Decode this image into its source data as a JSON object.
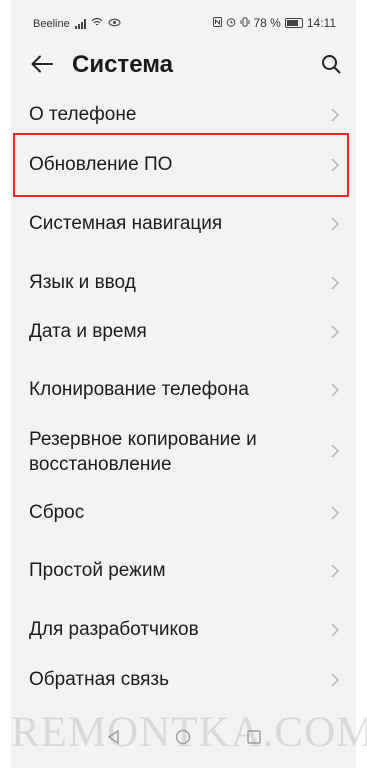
{
  "status_bar": {
    "carrier": "Beeline",
    "battery_percent": "78 %",
    "time": "14:11"
  },
  "header": {
    "title": "Система",
    "back_icon": "arrow-left-icon",
    "search_icon": "search-icon"
  },
  "menu": {
    "items": [
      {
        "label": "О телефоне"
      },
      {
        "label": "Обновление ПО",
        "highlighted": true
      },
      {
        "label": "Системная навигация"
      },
      {
        "label": "Язык и ввод"
      },
      {
        "label": "Дата и время"
      },
      {
        "label": "Клонирование телефона"
      },
      {
        "label": "Резервное копирование и",
        "label_line2": "восстановление"
      },
      {
        "label": "Сброс"
      },
      {
        "label": "Простой режим"
      },
      {
        "label": "Для разработчиков"
      },
      {
        "label": "Обратная связь"
      }
    ]
  },
  "watermark": "REMONTKA.COM",
  "colors": {
    "highlight_border": "#e8262c",
    "background": "#f1f3f5",
    "chevron": "#b5b5b5"
  }
}
